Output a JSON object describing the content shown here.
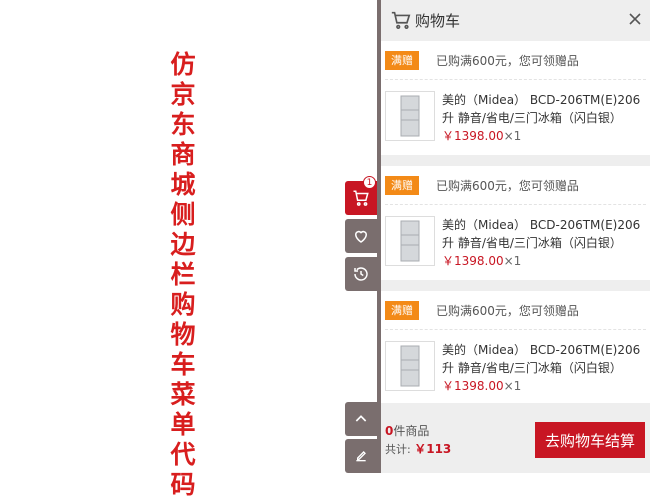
{
  "page_title": "仿京东商城侧边栏购物车菜单代码",
  "toolbar": {
    "cart_badge": "1"
  },
  "panel": {
    "title": "购物车",
    "groups": [
      {
        "promo_tag": "满赠",
        "promo_text": "已购满600元，您可领赠品",
        "item": {
          "name": "美的（Midea） BCD-206TM(E)206升 静音/省电/三门冰箱（闪白银）",
          "price": "￥1398.00",
          "qty": "×1"
        }
      },
      {
        "promo_tag": "满赠",
        "promo_text": "已购满600元，您可领赠品",
        "item": {
          "name": "美的（Midea） BCD-206TM(E)206升 静音/省电/三门冰箱（闪白银）",
          "price": "￥1398.00",
          "qty": "×1"
        }
      },
      {
        "promo_tag": "满赠",
        "promo_text": "已购满600元，您可领赠品",
        "item": {
          "name": "美的（Midea） BCD-206TM(E)206升 静音/省电/三门冰箱（闪白银）",
          "price": "￥1398.00",
          "qty": "×1"
        }
      }
    ],
    "footer": {
      "count": "0",
      "count_label": "件商品",
      "total_label": "共计:",
      "total": "￥113",
      "checkout_label": "去购物车结算"
    }
  },
  "colors": {
    "accent": "#c81623",
    "toolbar": "#7a6e6e",
    "promo": "#f38a17"
  }
}
